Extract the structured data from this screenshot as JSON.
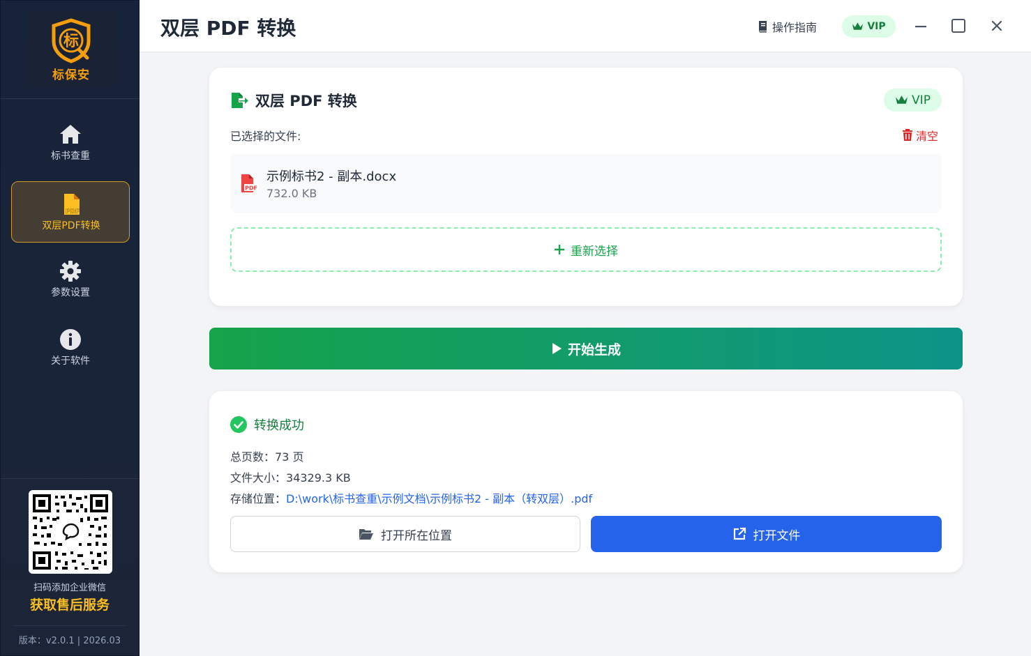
{
  "sidebar": {
    "logo_text": "标保安",
    "logo_glyph": "标",
    "items": [
      {
        "label": "标书查重",
        "icon": "home-icon"
      },
      {
        "label": "双层PDF转换",
        "icon": "pdf-file-icon",
        "active": true
      },
      {
        "label": "参数设置",
        "icon": "gear-icon"
      },
      {
        "label": "关于软件",
        "icon": "info-icon"
      }
    ],
    "qr_caption": "扫码添加企业微信",
    "qr_service": "获取售后服务",
    "version": "版本：v2.0.1 | 2026.03"
  },
  "header": {
    "title": "双层 PDF 转换",
    "guide_label": "操作指南",
    "vip_label": "VIP"
  },
  "file_card": {
    "title": "双层 PDF 转换",
    "vip_label": "VIP",
    "selected_label": "已选择的文件:",
    "clear_label": "清空",
    "file": {
      "name": "示例标书2 - 副本.docx",
      "size": "732.0 KB"
    },
    "reselect_label": "重新选择"
  },
  "start_label": "开始生成",
  "result_card": {
    "status": "转换成功",
    "pages_label": "总页数：",
    "pages_value": "73 页",
    "size_label": "文件大小：",
    "size_value": "34329.3 KB",
    "path_label": "存储位置：",
    "path_value": "D:\\work\\标书查重\\示例文档\\示例标书2 - 副本（转双层）.pdf",
    "open_location_label": "打开所在位置",
    "open_file_label": "打开文件"
  },
  "colors": {
    "accent_green": "#16a34a",
    "accent_blue": "#2563eb",
    "sidebar_bg": "#17233a",
    "gold": "#fbbf24",
    "danger": "#dc2626"
  }
}
